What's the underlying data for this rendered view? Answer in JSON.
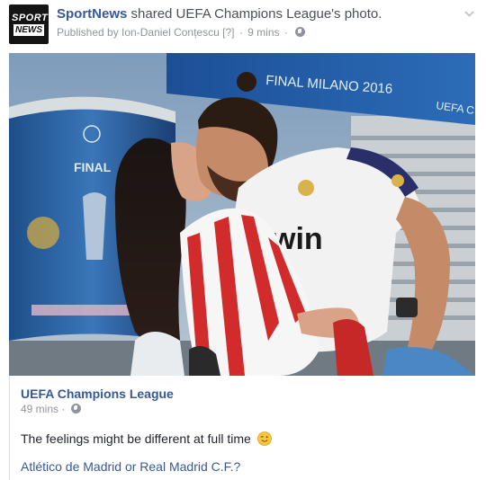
{
  "post": {
    "page_name": "SportNews",
    "shared_text": " shared UEFA Champions League's photo.",
    "published_by": "Published by Ion-Daniel Conțescu",
    "info_marker": "[?]",
    "time": "9 mins",
    "privacy_icon": "globe-icon",
    "menu_icon": "chevron-down-icon"
  },
  "avatar": {
    "line1": "SPORT",
    "line2": "NEWS"
  },
  "photo": {
    "banner_text": "FINAL MILANO 2016",
    "banner_text_right": "UEFA C",
    "pillar_text": "FINAL",
    "shirt_text": "win"
  },
  "shared": {
    "page_name": "UEFA Champions League",
    "time": "49 mins",
    "message": "The feelings might be different at full time",
    "emoji_icon": "wink-emoji-icon",
    "link_text": "Atlético de Madrid or Real Madrid C.F.?"
  },
  "colors": {
    "link": "#365899",
    "meta": "#90949c",
    "text": "#1d2129"
  }
}
